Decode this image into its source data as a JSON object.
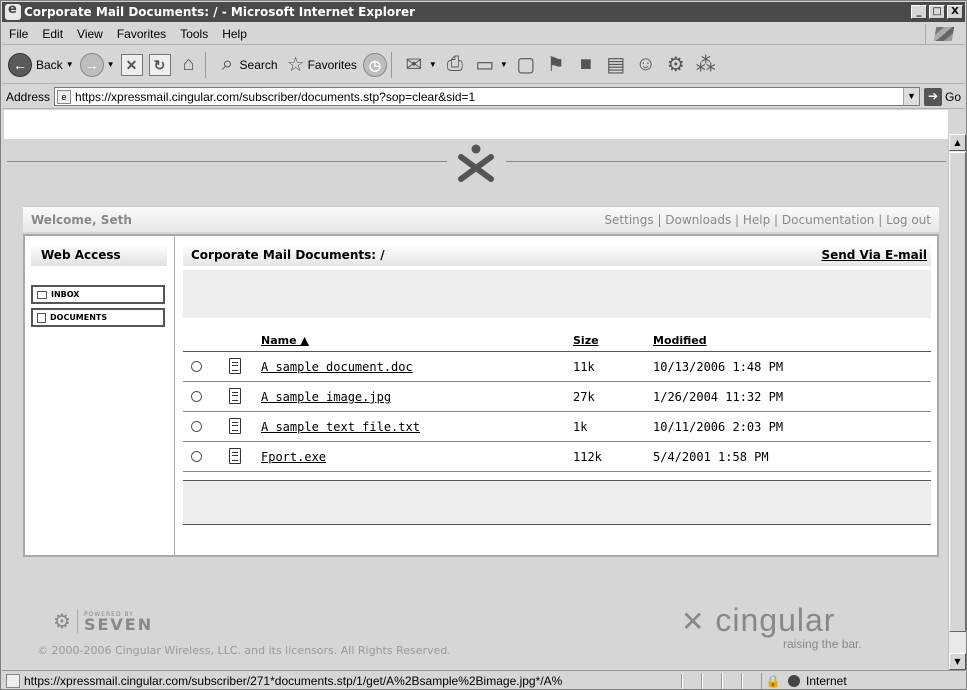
{
  "window": {
    "title": "Corporate Mail Documents: / - Microsoft Internet Explorer",
    "min": "_",
    "max": "□",
    "close": "X"
  },
  "menu": [
    {
      "label": "File"
    },
    {
      "label": "Edit"
    },
    {
      "label": "View"
    },
    {
      "label": "Favorites"
    },
    {
      "label": "Tools"
    },
    {
      "label": "Help"
    }
  ],
  "toolbar": {
    "back": "Back",
    "search": "Search",
    "favorites": "Favorites"
  },
  "address": {
    "label": "Address",
    "url": "https://xpressmail.cingular.com/subscriber/documents.stp?sop=clear&sid=1",
    "go": "Go"
  },
  "page": {
    "welcome": "Welcome, Seth",
    "top_links": [
      "Settings",
      "Downloads",
      "Help",
      "Documentation",
      "Log out"
    ],
    "sidebar_title": "Web Access",
    "sidebar_items": [
      "INBOX",
      "DOCUMENTS"
    ],
    "panel_title": "Corporate Mail Documents: /",
    "send_link": "Send Via E-mail",
    "columns": {
      "name": "Name ▲",
      "size": "Size",
      "modified": "Modified"
    },
    "files": [
      {
        "name": "A sample document.doc",
        "size": "11k",
        "modified": "10/13/2006 1:48 PM"
      },
      {
        "name": "A sample image.jpg",
        "size": "27k",
        "modified": "1/26/2004 11:32 PM"
      },
      {
        "name": "A sample text file.txt",
        "size": "1k",
        "modified": "10/11/2006 2:03 PM"
      },
      {
        "name": "Fport.exe",
        "size": "112k",
        "modified": "5/4/2001 1:58 PM"
      }
    ],
    "powered_small": "POWERED BY",
    "powered_big": "SEVEN",
    "copyright": "© 2000-2006 Cingular Wireless, LLC. and its licensors. All Rights Reserved.",
    "brand": "cingular",
    "brand_tag": "raising the bar."
  },
  "status": {
    "url": "https://xpressmail.cingular.com/subscriber/271*documents.stp/1/get/A%2Bsample%2Bimage.jpg*/A%",
    "zone": "Internet"
  }
}
